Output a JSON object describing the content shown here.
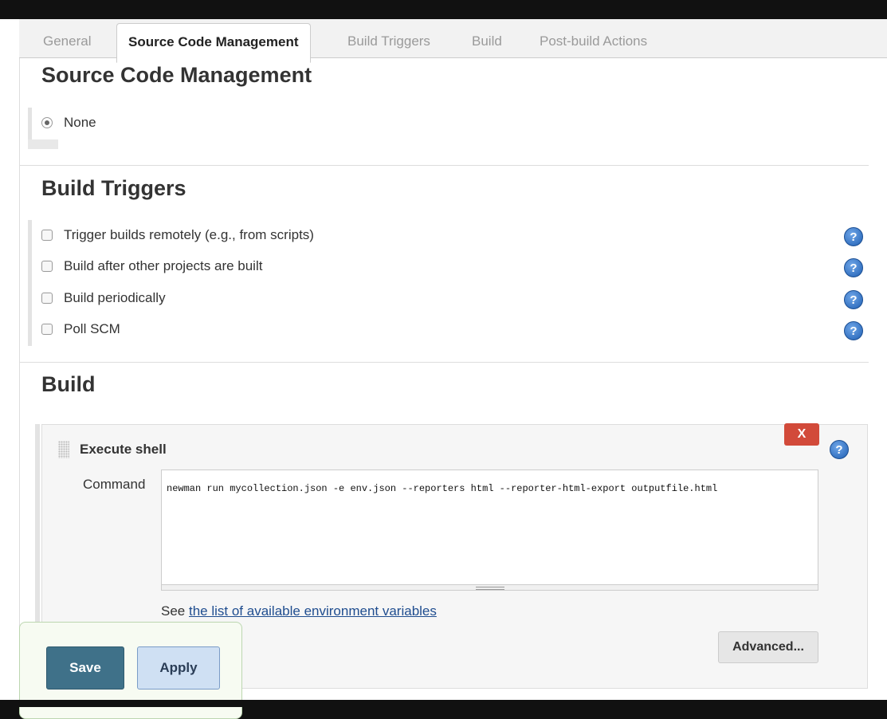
{
  "tabs": [
    {
      "label": "General"
    },
    {
      "label": "Source Code Management"
    },
    {
      "label": "Build Triggers"
    },
    {
      "label": "Build"
    },
    {
      "label": "Post-build Actions"
    }
  ],
  "active_tab": "Source Code Management",
  "scm": {
    "title": "Source Code Management",
    "options": [
      {
        "label": "None",
        "selected": true
      }
    ]
  },
  "triggers": {
    "title": "Build Triggers",
    "items": [
      {
        "label": "Trigger builds remotely (e.g., from scripts)",
        "checked": false
      },
      {
        "label": "Build after other projects are built",
        "checked": false
      },
      {
        "label": "Build periodically",
        "checked": false
      },
      {
        "label": "Poll SCM",
        "checked": false
      }
    ]
  },
  "build": {
    "title": "Build",
    "step": {
      "title": "Execute shell",
      "close_label": "X",
      "command_label": "Command",
      "command_value": "newman run mycollection.json -e env.json --reporters html --reporter-html-export outputfile.html",
      "env_prefix": "See",
      "env_link": "the list of available environment variables",
      "advanced_label": "Advanced..."
    }
  },
  "actions": {
    "save_label": "Save",
    "apply_label": "Apply"
  },
  "icons": {
    "help": "help-icon",
    "grip": "drag-handle-icon"
  },
  "colors": {
    "save": "#3f7189",
    "apply": "#cfe0f3",
    "close": "#d24a3a",
    "help": "#1f5fb3"
  }
}
